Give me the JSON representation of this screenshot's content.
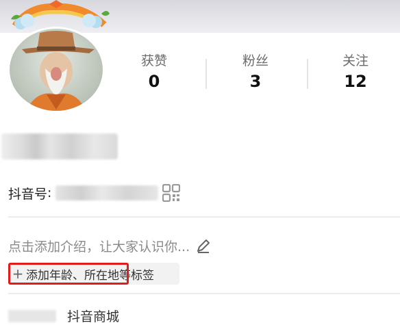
{
  "profile": {
    "stats": [
      {
        "label": "获赞",
        "value": "0"
      },
      {
        "label": "粉丝",
        "value": "3"
      },
      {
        "label": "关注",
        "value": "12"
      }
    ],
    "id_label": "抖音号",
    "bio_placeholder": "点击添加介绍，让大家认识你...",
    "tag_text": "添加年龄、所在地等标签",
    "tag_plus": "+",
    "bottom_item": "抖音商城"
  },
  "icons": [
    "avatar-image",
    "qr-code-icon",
    "pencil-icon",
    "plus-icon"
  ],
  "colors": {
    "highlight_box": "#e21b1b",
    "stat_label": "#6b6b6b",
    "bio_text": "#8a8a8a"
  }
}
